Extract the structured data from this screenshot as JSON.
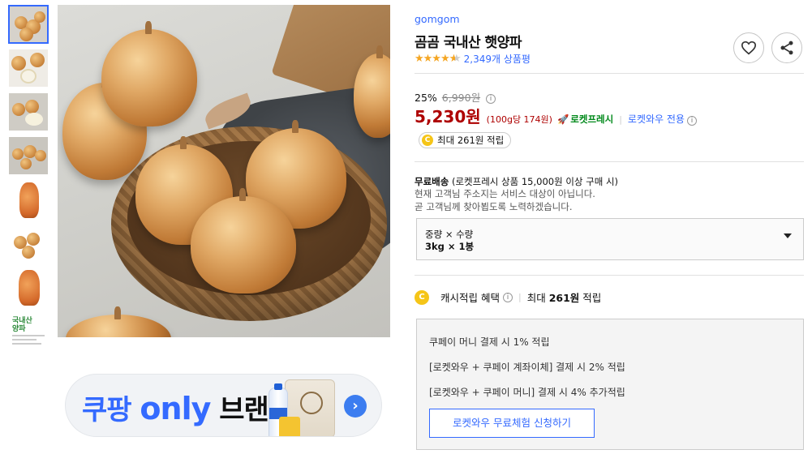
{
  "thumbnails": [
    "thumb-1",
    "thumb-2",
    "thumb-3",
    "thumb-4",
    "thumb-5",
    "thumb-6",
    "thumb-7",
    "thumb-8"
  ],
  "thumb_8_text": "국내산\n양파",
  "banner": {
    "part1": "쿠팡",
    "part2": "only",
    "part3": "브랜드",
    "arrow": "›"
  },
  "product": {
    "brand": "gomgom",
    "title": "곰곰 국내산 햇양파",
    "rating": 4.5,
    "stars": "★★★★",
    "half_star": "★",
    "review_count": "2,349개 상품평"
  },
  "pricing": {
    "discount_rate": "25%",
    "original_price": "6,990원",
    "info_icon": "i",
    "price": "5,230원",
    "unit_price": "(100g당 174원)",
    "rocket_label": "로켓프레시",
    "rocket_icon": "🚀",
    "separator": "|",
    "wow_label": "로켓와우 전용"
  },
  "cash_pill": {
    "coin": "C",
    "text": "최대 261원 적립"
  },
  "shipping": {
    "free_label": "무료배송",
    "condition": "(로켓프레시 상품 15,000원 이상 구매 시)",
    "line2": "현재 고객님 주소지는 서비스 대상이 아닙니다.",
    "line3": "곧 고객님께 찾아뵙도록 노력하겠습니다."
  },
  "option": {
    "label": "중량 × 수량",
    "value": "3kg × 1봉"
  },
  "cash_benefit": {
    "coin": "C",
    "label": "캐시적립 혜택",
    "separator": "|",
    "max_prefix": "최대 ",
    "max_amount": "261원",
    "max_suffix": " 적립"
  },
  "benefits": {
    "lines": [
      "쿠페이 머니 결제 시 1% 적립",
      "[로켓와우 + 쿠페이 계좌이체] 결제 시 2% 적립",
      "[로켓와우 + 쿠페이 머니] 결제 시 4% 추가적립"
    ],
    "button": "로켓와우 무료체험 신청하기"
  },
  "colors": {
    "accent": "#346aff",
    "price": "#ae0000",
    "rocket": "#00891a",
    "star": "#f5a623",
    "coin": "#f5c518"
  }
}
